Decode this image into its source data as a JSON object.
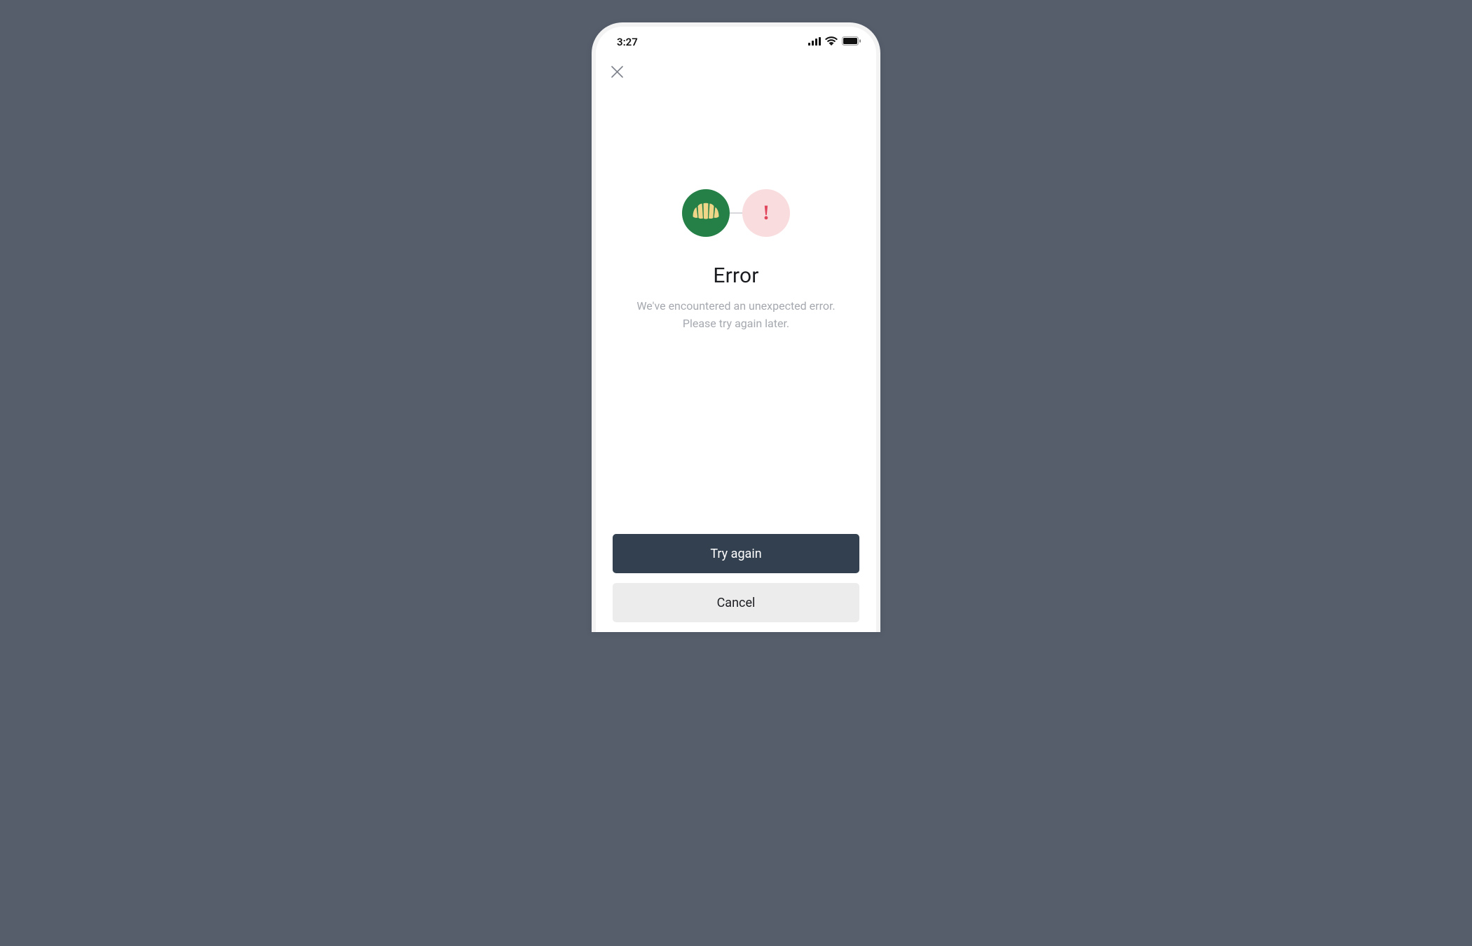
{
  "status_bar": {
    "time": "3:27"
  },
  "error": {
    "title": "Error",
    "message": "We've encountered an unexpected error.\nPlease try again later."
  },
  "buttons": {
    "primary": "Try again",
    "secondary": "Cancel"
  },
  "colors": {
    "background": "#565e6c",
    "brand_green": "#258048",
    "error_pink": "#f9dcde",
    "error_red": "#e0455c",
    "primary_button": "#33404f",
    "secondary_button": "#ececec"
  }
}
